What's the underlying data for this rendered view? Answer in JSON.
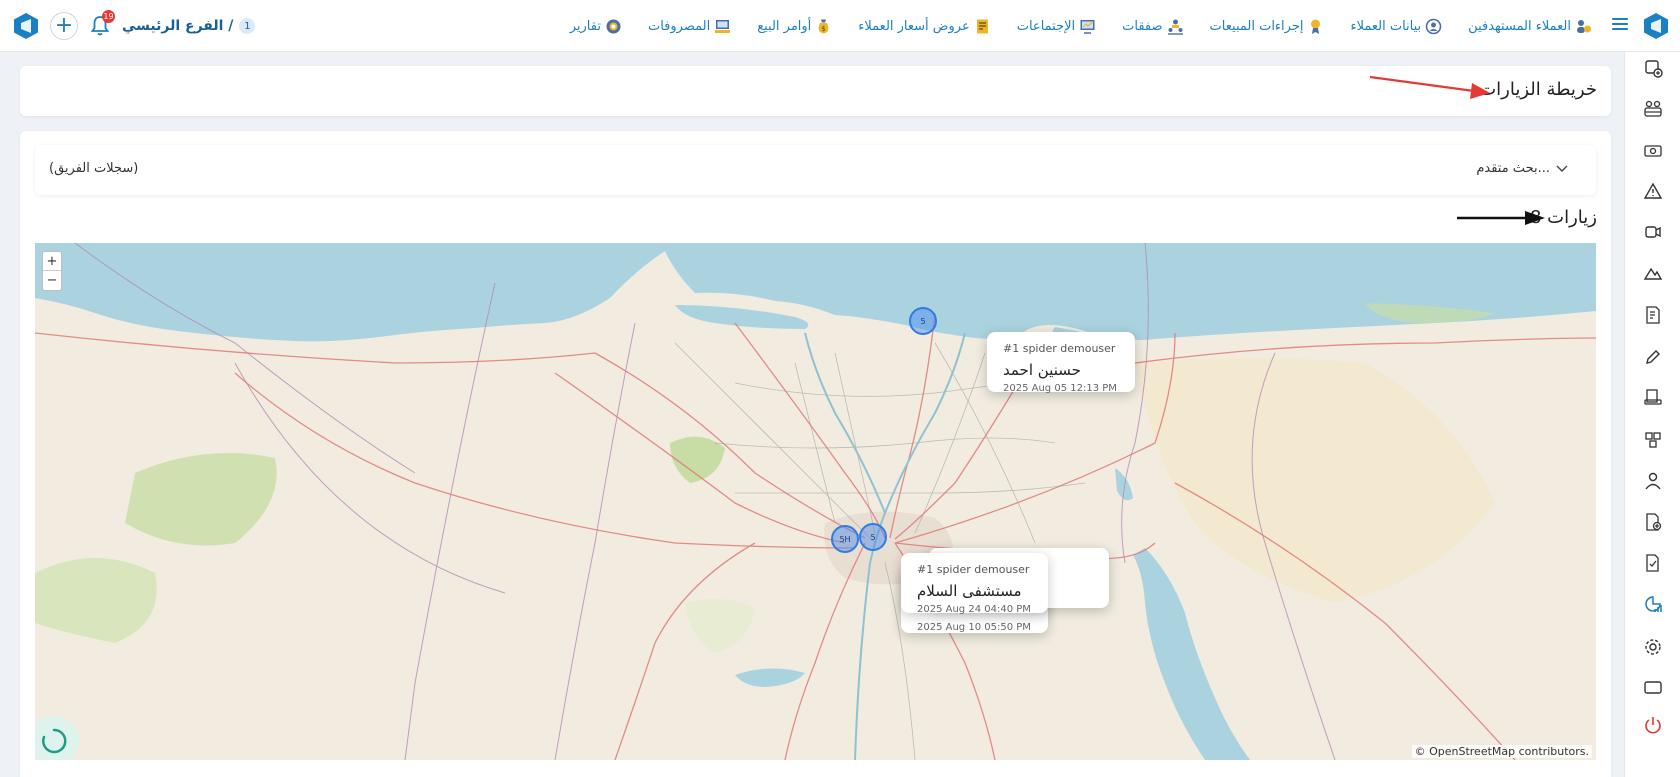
{
  "nav": {
    "items": [
      {
        "label": "العملاء المستهدفين",
        "icon": "target-customers-icon"
      },
      {
        "label": "بيانات العملاء",
        "icon": "customer-data-icon"
      },
      {
        "label": "إجراءات المبيعات",
        "icon": "sales-actions-icon"
      },
      {
        "label": "صفقات",
        "icon": "deals-icon"
      },
      {
        "label": "الإجتماعات",
        "icon": "meetings-icon"
      },
      {
        "label": "عروض أسعار العملاء",
        "icon": "quotes-icon"
      },
      {
        "label": "أوامر البيع",
        "icon": "sales-orders-icon"
      },
      {
        "label": "المصروفات",
        "icon": "expenses-icon"
      },
      {
        "label": "تقارير",
        "icon": "reports-icon"
      }
    ]
  },
  "header": {
    "branch_label": "الفرع الرئيسي /",
    "branch_number": "1",
    "notification_count": "19"
  },
  "page": {
    "title": "خريطة الزيارات",
    "advanced_search": "بحث متقدم...",
    "team_records": "(سجلات الفريق)",
    "visits_count": "8 زيارات"
  },
  "map": {
    "zoom_in": "+",
    "zoom_out": "−",
    "attribution": "© OpenStreetMap contributors.",
    "markers": [
      {
        "label": "5"
      },
      {
        "label": "5H"
      },
      {
        "label": "5"
      }
    ],
    "popups": [
      {
        "user": "#1 spider demouser",
        "place": "حسنين احمد",
        "time": "2025 Aug 05 12:13 PM"
      },
      {
        "user": "#1 spider demouser",
        "place": "مستشفى السلام",
        "time": "2025 Aug 24 04:40 PM"
      },
      {
        "time": "2025 Aug 10 05:50 PM"
      }
    ]
  },
  "colors": {
    "brand": "#1b7fc4",
    "accent_red": "#e53935",
    "sea": "#aad3df",
    "land": "#f1ecdf"
  }
}
